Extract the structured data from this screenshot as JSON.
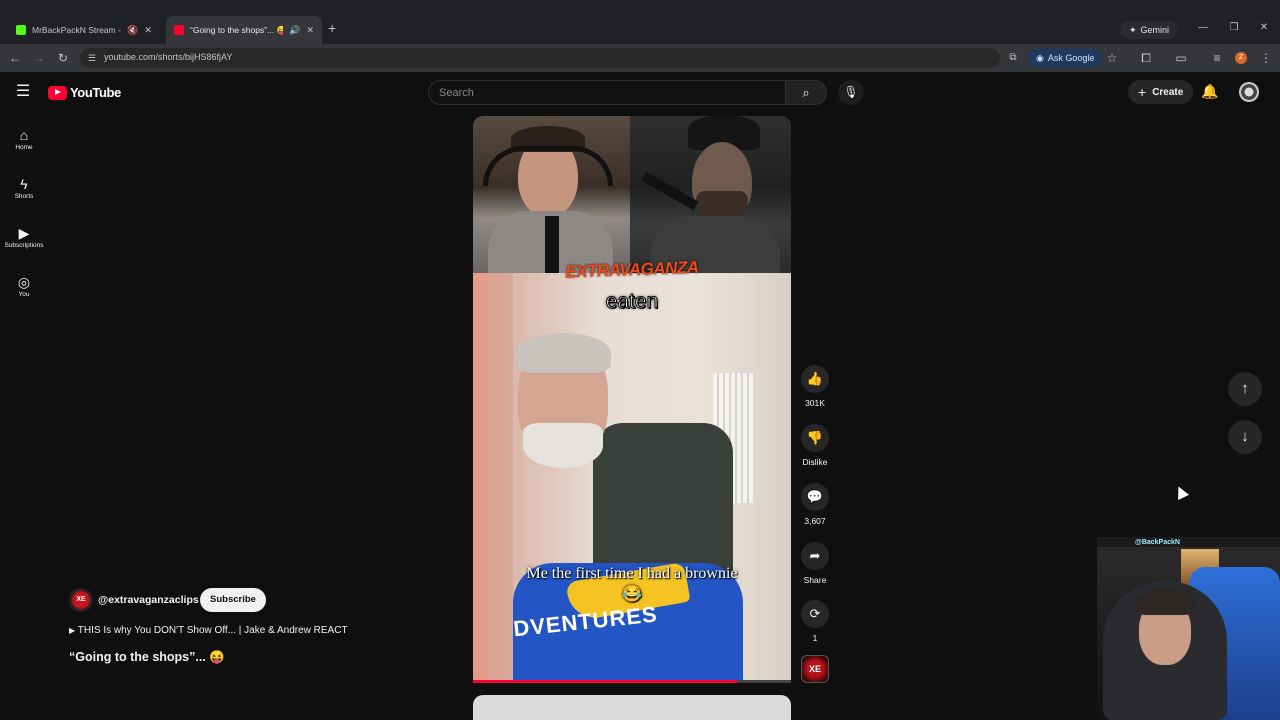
{
  "browser": {
    "tabs": [
      {
        "title": "MrBackPackN Stream - Wa",
        "favicon_color": "#53fc18",
        "active": false
      },
      {
        "title": "“Going to the shops”... 😝",
        "favicon_color": "#ff0033",
        "active": true
      }
    ],
    "new_tab": "+",
    "gemini_label": "Gemini",
    "url": "youtube.com/shorts/bijHS86fjAY",
    "ask_google_label": "Ask Google",
    "profile_letter": "Z"
  },
  "youtube": {
    "logo_text": "YouTube",
    "search_placeholder": "Search",
    "create_label": "Create",
    "sidebar": [
      {
        "label": "Home",
        "icon": "home-icon"
      },
      {
        "label": "Shorts",
        "icon": "shorts-icon"
      },
      {
        "label": "Subscriptions",
        "icon": "subscriptions-icon"
      },
      {
        "label": "You",
        "icon": "you-icon"
      }
    ]
  },
  "short": {
    "channel_badge": "XE",
    "overlay_logo": "EXTRAVAGANZA",
    "caption_top": "eaten",
    "caption_bottom": "Me the first time I had a brownie 😂",
    "shirt_text": "DVENTURES",
    "progress": 0.83,
    "actions": {
      "likes": "301K",
      "dislike": "Dislike",
      "comments": "3,607",
      "share": "Share",
      "remix": "1"
    },
    "channel": "@extravaganzaclips",
    "subscribe_label": "Subscribe",
    "related_video": "THIS Is why You DON'T Show Off... | Jake & Andrew REACT",
    "title": "“Going to the shops”... 😝"
  },
  "overlay": {
    "tag": "@BackPackN"
  }
}
